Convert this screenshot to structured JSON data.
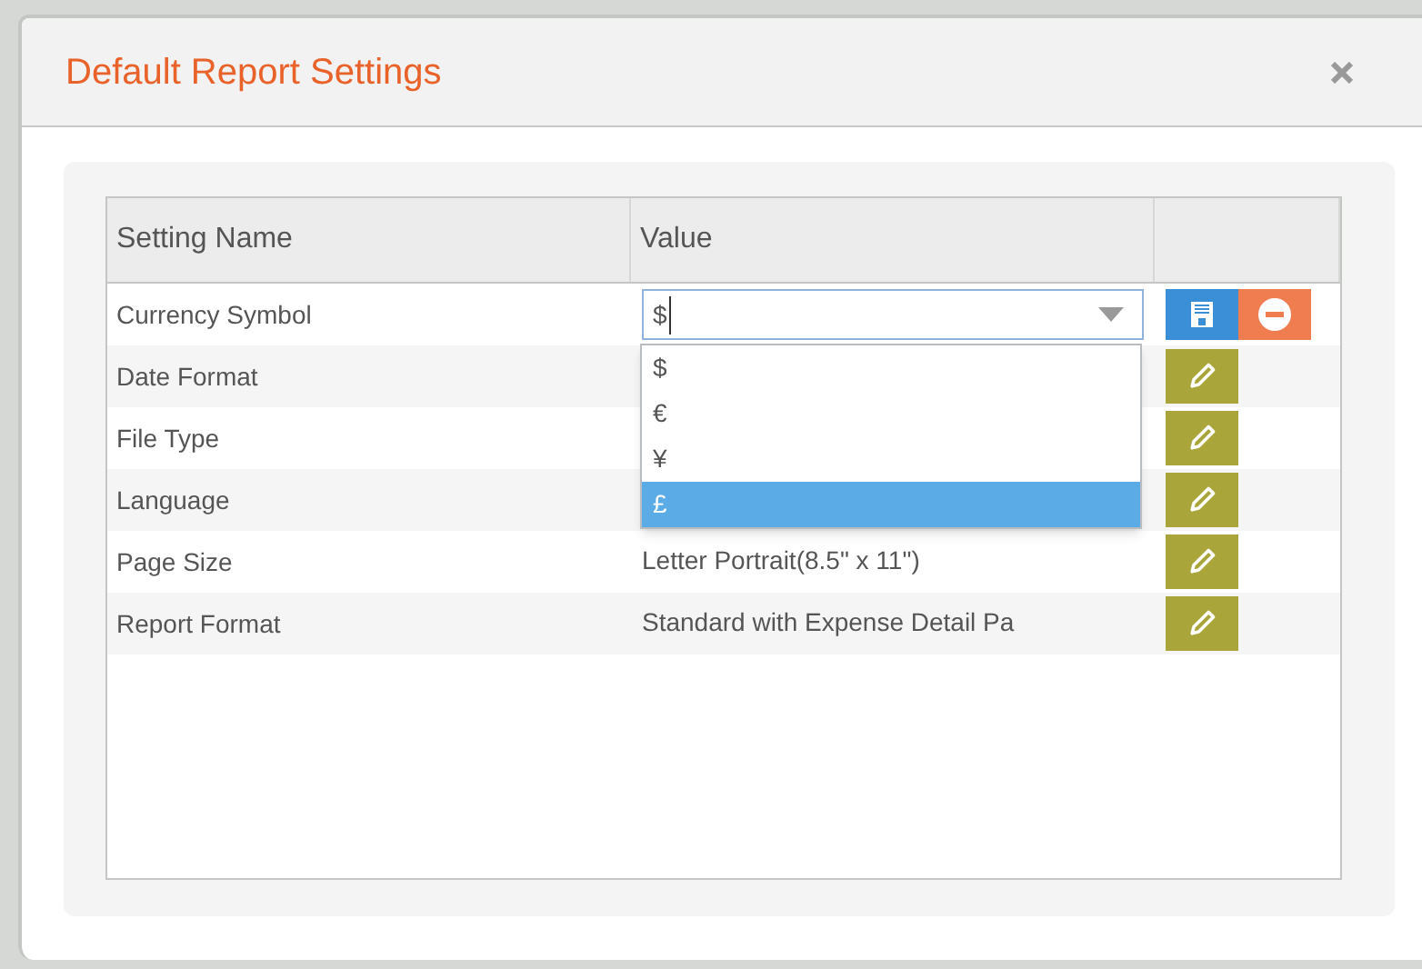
{
  "dialog": {
    "title": "Default Report Settings"
  },
  "table": {
    "columns": [
      "Setting Name",
      "Value"
    ],
    "rows": [
      {
        "name": "Currency Symbol",
        "editing": true,
        "value": "$"
      },
      {
        "name": "Date Format",
        "editing": false
      },
      {
        "name": "File Type",
        "editing": false
      },
      {
        "name": "Language",
        "editing": false
      },
      {
        "name": "Page Size",
        "editing": false,
        "value": "Letter Portrait(8.5\" x 11\")"
      },
      {
        "name": "Report Format",
        "editing": false,
        "value": "Standard with Expense Detail Pa"
      }
    ]
  },
  "dropdown": {
    "options": [
      {
        "label": "$",
        "selected": false
      },
      {
        "label": "€",
        "selected": false
      },
      {
        "label": "¥",
        "selected": false
      },
      {
        "label": "£",
        "selected": true
      }
    ]
  }
}
